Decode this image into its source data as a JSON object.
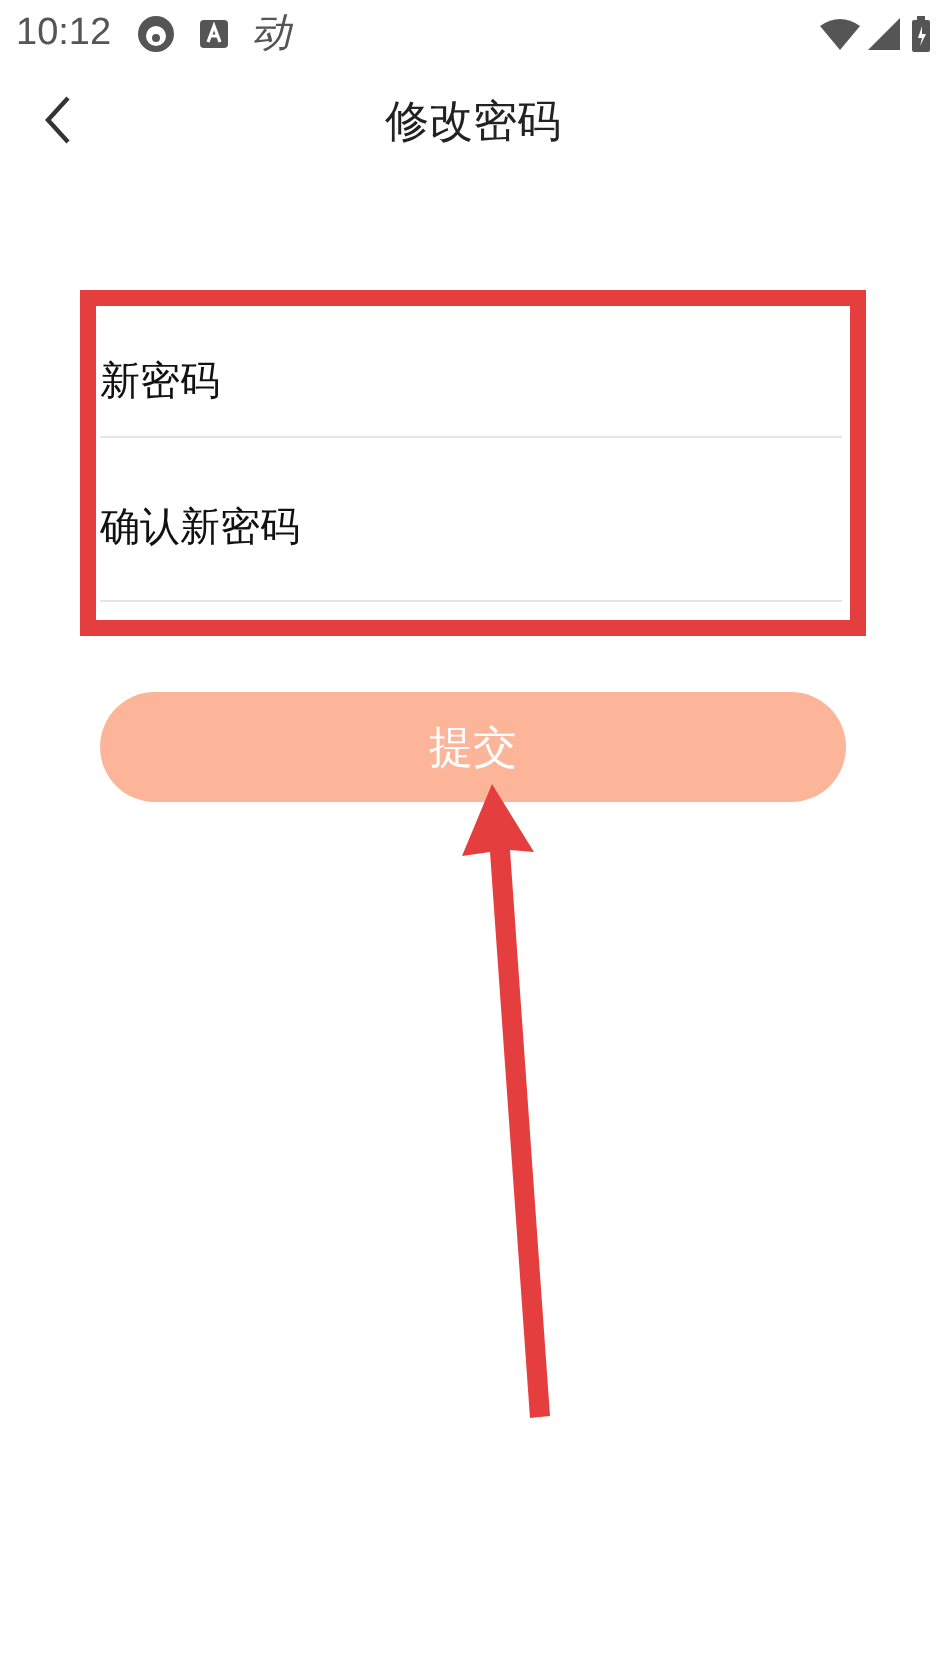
{
  "status_bar": {
    "time": "10:12",
    "app_glyph": "动"
  },
  "nav": {
    "title": "修改密码"
  },
  "form": {
    "fields": [
      {
        "placeholder": "新密码"
      },
      {
        "placeholder": "确认新密码"
      }
    ]
  },
  "submit_button": {
    "label": "提交"
  }
}
